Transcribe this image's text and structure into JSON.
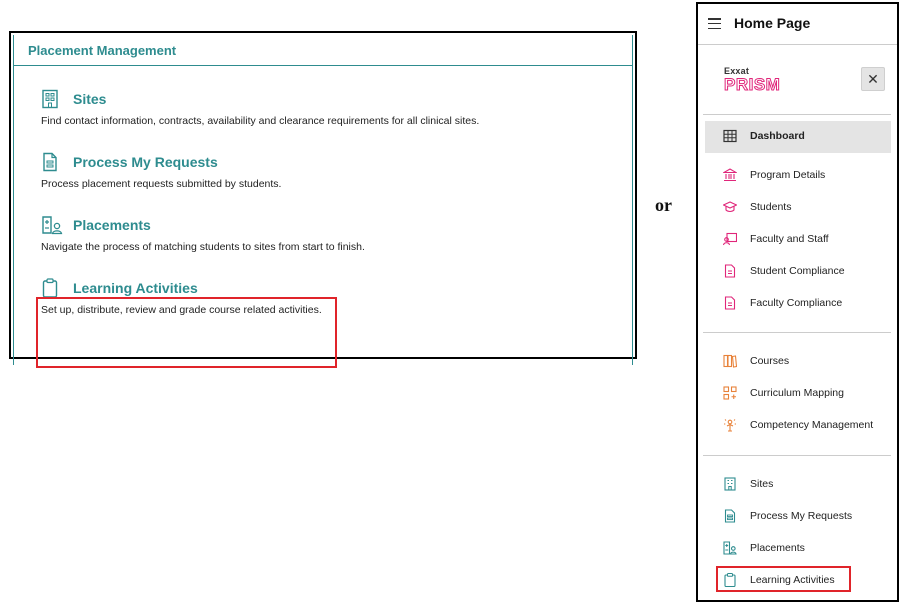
{
  "placement_management": {
    "title": "Placement Management",
    "items": [
      {
        "icon": "building-icon",
        "title": "Sites",
        "description": "Find contact information, contracts, availability and clearance requirements for all clinical sites."
      },
      {
        "icon": "document-icon",
        "title": "Process My Requests",
        "description": "Process placement requests submitted by students."
      },
      {
        "icon": "placements-icon",
        "title": "Placements",
        "description": "Navigate the process of matching students to sites from start to finish."
      },
      {
        "icon": "clipboard-icon",
        "title": "Learning Activities",
        "description": "Set up, distribute, review and grade course related activities."
      }
    ]
  },
  "separator_text": "or",
  "sidebar": {
    "header_title": "Home Page",
    "logo_top": "Exxat",
    "logo_main": "PRISM",
    "close_symbol": "✕",
    "items": [
      {
        "label": "Dashboard",
        "icon": "grid-icon"
      },
      {
        "label": "Program Details",
        "icon": "institution-icon"
      },
      {
        "label": "Students",
        "icon": "graduation-cap-icon"
      },
      {
        "label": "Faculty and Staff",
        "icon": "faculty-icon"
      },
      {
        "label": "Student Compliance",
        "icon": "document-icon"
      },
      {
        "label": "Faculty Compliance",
        "icon": "document-icon"
      },
      {
        "label": "Courses",
        "icon": "books-icon"
      },
      {
        "label": "Curriculum Mapping",
        "icon": "mapping-icon"
      },
      {
        "label": "Competency Management",
        "icon": "competency-icon"
      },
      {
        "label": "Sites",
        "icon": "building-icon"
      },
      {
        "label": "Process My Requests",
        "icon": "document-icon"
      },
      {
        "label": "Placements",
        "icon": "placements-icon"
      },
      {
        "label": "Learning Activities",
        "icon": "clipboard-icon"
      }
    ]
  },
  "colors": {
    "teal": "#2e8c8f",
    "pink": "#e0267a",
    "orange": "#e8823a",
    "highlight": "#e0242a"
  }
}
